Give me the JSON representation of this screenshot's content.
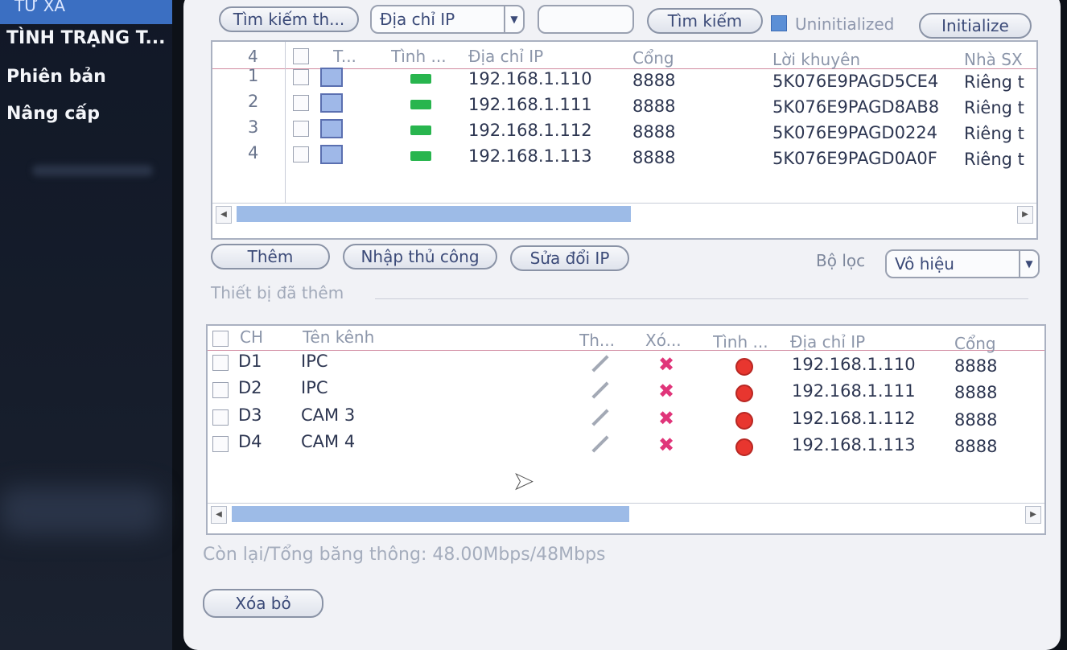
{
  "sidebar": {
    "top_item": "TỪ XA",
    "items": [
      {
        "label": "TÌNH TRẠNG T..."
      },
      {
        "label": "Phiên bản"
      },
      {
        "label": "Nâng cấp"
      }
    ]
  },
  "toolbar": {
    "search_type_label": "Tìm kiếm th...",
    "ip_select_value": "Địa chỉ IP",
    "search_input_value": "",
    "search_button": "Tìm kiếm",
    "uninitialized_label": "Uninitialized",
    "initialize_button": "Initialize"
  },
  "search_table": {
    "count": "4",
    "headers": {
      "type": "T...",
      "status": "Tình ...",
      "ip": "Địa chỉ IP",
      "port": "Cổng",
      "advice": "Lời khuyên",
      "vendor": "Nhà SX"
    },
    "rows": [
      {
        "no": "1",
        "ip": "192.168.1.110",
        "port": "8888",
        "advice": "5K076E9PAGD5CE4",
        "vendor": "Riêng t"
      },
      {
        "no": "2",
        "ip": "192.168.1.111",
        "port": "8888",
        "advice": "5K076E9PAGD8AB8",
        "vendor": "Riêng t"
      },
      {
        "no": "3",
        "ip": "192.168.1.112",
        "port": "8888",
        "advice": "5K076E9PAGD0224",
        "vendor": "Riêng t"
      },
      {
        "no": "4",
        "ip": "192.168.1.113",
        "port": "8888",
        "advice": "5K076E9PAGD0A0F",
        "vendor": "Riêng t"
      }
    ]
  },
  "actions": {
    "add_button": "Thêm",
    "manual_button": "Nhập thủ công",
    "edit_ip_button": "Sửa đổi IP",
    "filter_label": "Bộ lọc",
    "filter_value": "Vô hiệu"
  },
  "added_section_label": "Thiết bị đã thêm",
  "added_table": {
    "headers": {
      "ch": "CH",
      "name": "Tên kênh",
      "edit": "Th...",
      "delete": "Xó...",
      "status": "Tình ...",
      "ip": "Địa chỉ IP",
      "port": "Cổng"
    },
    "rows": [
      {
        "ch": "D1",
        "name": "IPC",
        "ip": "192.168.1.110",
        "port": "8888"
      },
      {
        "ch": "D2",
        "name": "IPC",
        "ip": "192.168.1.111",
        "port": "8888"
      },
      {
        "ch": "D3",
        "name": "CAM 3",
        "ip": "192.168.1.112",
        "port": "8888"
      },
      {
        "ch": "D4",
        "name": "CAM 4",
        "ip": "192.168.1.113",
        "port": "8888"
      }
    ]
  },
  "bandwidth_text": "Còn lại/Tổng băng thông: 48.00Mbps/48Mbps",
  "delete_button": "Xóa bỏ",
  "icons": {
    "refresh": "refresh-icon",
    "camera": "camera-icon",
    "edit": "pencil-icon",
    "delete": "delete-x-icon",
    "status": "status-red-icon"
  },
  "colors": {
    "status_red": "#e8362f",
    "camera_green": "#28b54e",
    "scroll_thumb": "#9dbbe7"
  }
}
